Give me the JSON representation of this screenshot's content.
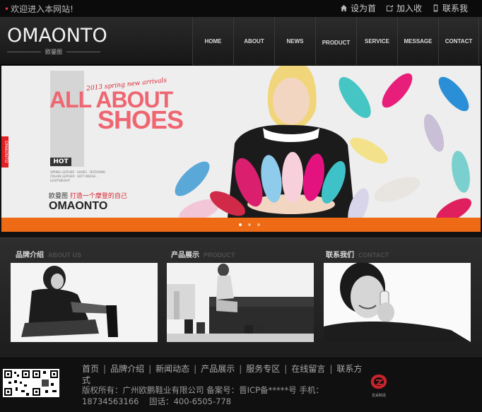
{
  "topbar": {
    "welcome": "欢迎进入本网站!",
    "links": [
      {
        "label": "设为首",
        "icon": "home-icon"
      },
      {
        "label": "加入收",
        "icon": "bookmark-icon"
      },
      {
        "label": "联系我",
        "icon": "phone-icon"
      }
    ]
  },
  "logo": {
    "brand": "OMAONTO",
    "sub": "欧曼图"
  },
  "nav": [
    "HOME",
    "ABOUT",
    "NEWS",
    "PRODUCT",
    "SERVICE",
    "MESSAGE",
    "CONTACT"
  ],
  "banner": {
    "script": "2013 spring new arrivals",
    "line1": "ALL ABOUT",
    "line2": "SHOES",
    "hot": "HOT",
    "small_text": "SPRING LEATHER · SHOES · FEATURING ITALIAN LEATHER · SOFT INSOLE · LIGHTWEIGHT",
    "cn_brand": "欧曼图",
    "cn_slogan": "打造一个摩登的自己",
    "logo": "OMAONTO",
    "side_tab": "OMAONTO",
    "colors": {
      "strip": "#ee6a14",
      "headline": "#ee6671"
    }
  },
  "sections": [
    {
      "title": "品牌介绍",
      "en": "ABOUT US"
    },
    {
      "title": "产品展示",
      "en": "PRODUCT"
    },
    {
      "title": "联系我们",
      "en": "CONTACT"
    }
  ],
  "footer": {
    "links": [
      "首页",
      "品牌介绍",
      "新闻动态",
      "产品展示",
      "服务专区",
      "在线留言",
      "联系方式"
    ],
    "info_line1": "版权所有：广州欧鹏鞋业有限公司 备案号：晋ICP备*****号 手机：",
    "info_line2": "18734563166    固话：400-6505-778",
    "badge_caption": "龙采制造"
  }
}
